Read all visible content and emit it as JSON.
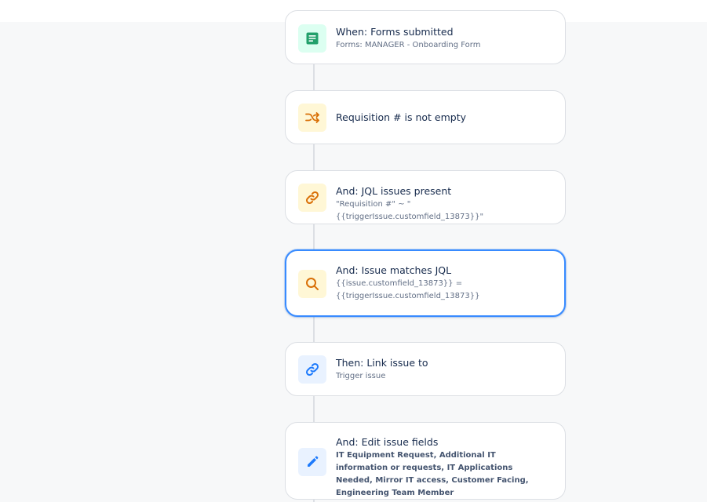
{
  "steps": [
    {
      "kind": "trigger",
      "icon": "form-icon",
      "title": "When: Forms submitted",
      "subtitle": "Forms: MANAGER - Onboarding Form"
    },
    {
      "kind": "condition",
      "icon": "shuffle-icon",
      "title": "Requisition # is not empty",
      "subtitle": ""
    },
    {
      "kind": "condition",
      "icon": "link-icon",
      "title": "And: JQL issues present",
      "subtitle": "\"Requisition #\" ~ \"{{triggerIssue.customfield_13873}}\""
    },
    {
      "kind": "condition",
      "icon": "search-icon",
      "title": "And: Issue matches JQL",
      "subtitle": "{{issue.customfield_13873}} = {{triggerIssue.customfield_13873}}",
      "selected": true
    },
    {
      "kind": "action",
      "icon": "link-icon",
      "title": "Then: Link issue to",
      "subtitle": "Trigger issue"
    },
    {
      "kind": "action",
      "icon": "pencil-icon",
      "title": "And: Edit issue fields",
      "subtitle": "IT Equipment Request, Additional IT information or requests, IT Applications Needed, Mirror IT access, Customer Facing, Engineering Team Member"
    }
  ],
  "colors": {
    "trigger_icon": "#22a06b",
    "condition_icon": "#d97008",
    "action_icon": "#1d7afc",
    "selected_border": "#388bff"
  }
}
